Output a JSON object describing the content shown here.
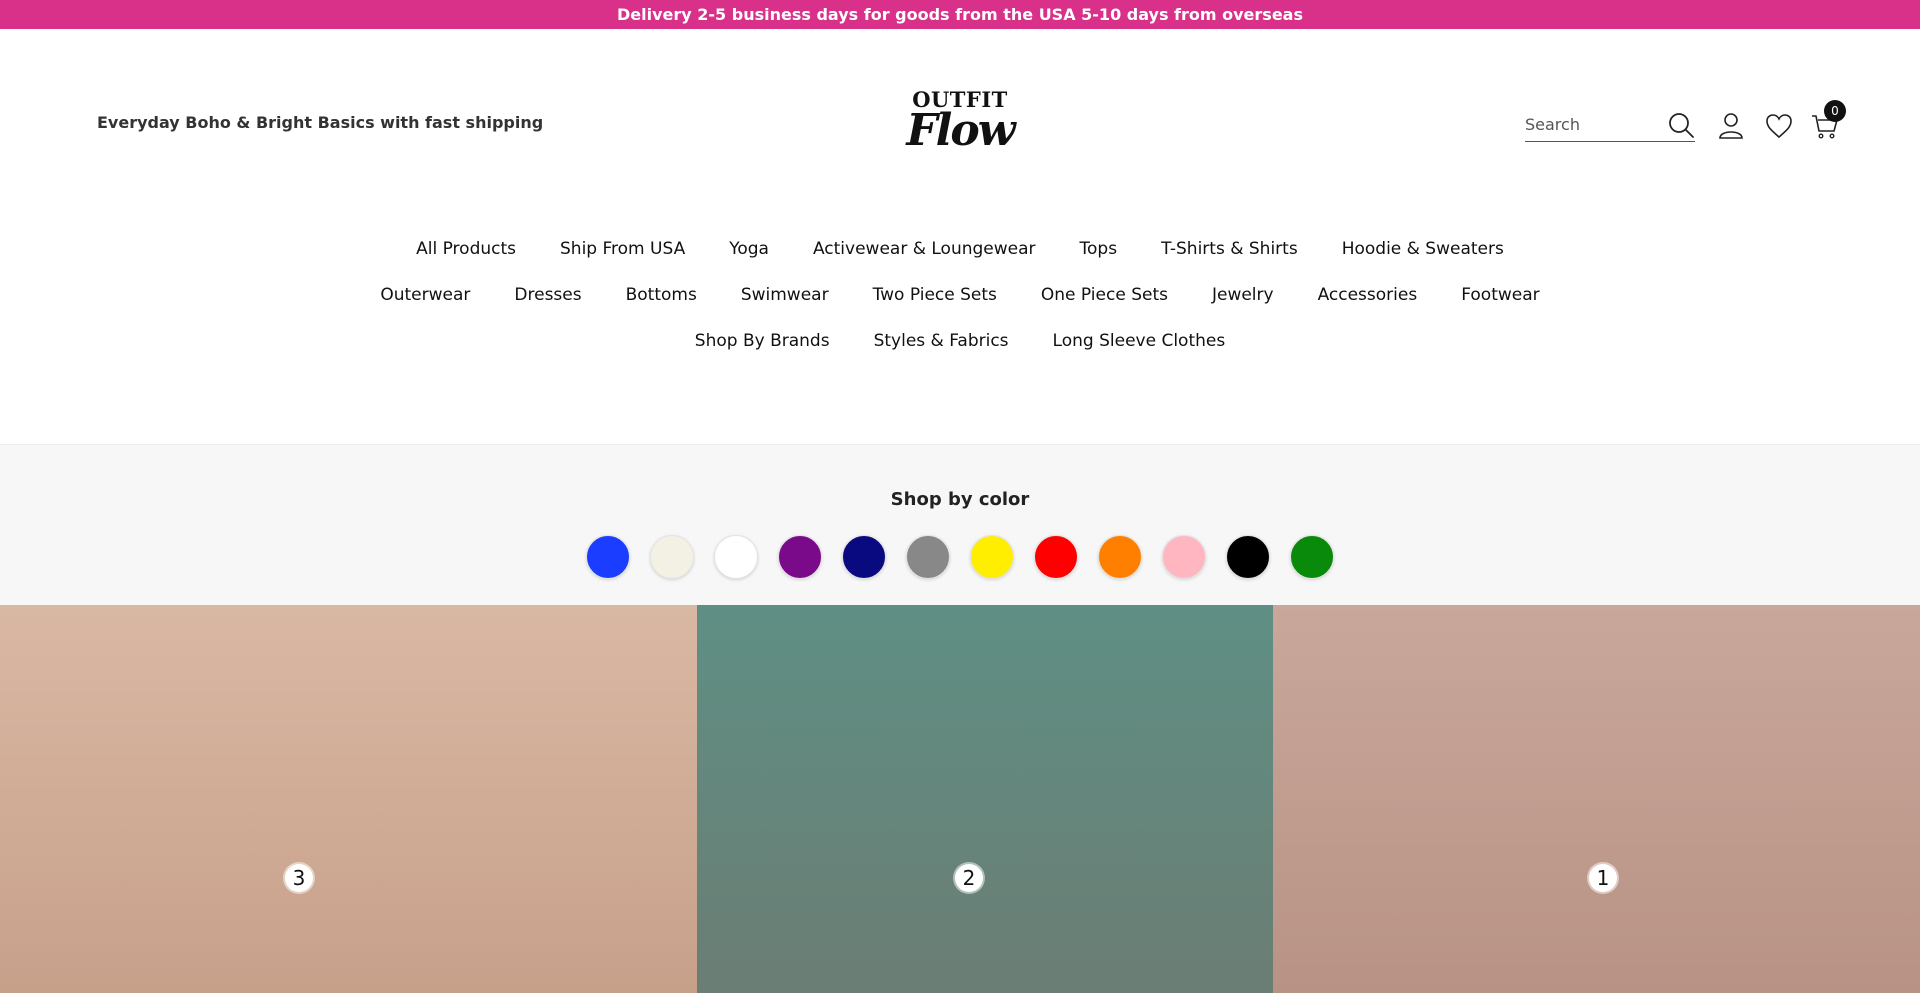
{
  "announcement": {
    "text": "Delivery 2-5 business days for goods from the USA 5-10 days from overseas"
  },
  "header": {
    "tagline": "Everyday Boho & Bright Basics with fast shipping",
    "logo": {
      "top": "OUTFIT",
      "bottom": "Flow"
    },
    "search": {
      "placeholder": "Search"
    },
    "cart_count": "0"
  },
  "nav": {
    "row1": [
      "All Products",
      "Ship From USA",
      "Yoga",
      "Activewear & Loungewear",
      "Tops",
      "T-Shirts & Shirts",
      "Hoodie & Sweaters"
    ],
    "row2": [
      "Outerwear",
      "Dresses",
      "Bottoms",
      "Swimwear",
      "Two Piece Sets",
      "One Piece Sets",
      "Jewelry",
      "Accessories",
      "Footwear"
    ],
    "row3": [
      "Shop By Brands",
      "Styles & Fabrics",
      "Long Sleeve Clothes"
    ]
  },
  "shop_by_color": {
    "title": "Shop by color",
    "colors": [
      "#1a3dff",
      "#f3f1e3",
      "#ffffff",
      "#7a0a8a",
      "#0a0a80",
      "#888888",
      "#ffee00",
      "#ff0000",
      "#ff8000",
      "#ffb6c1",
      "#000000",
      "#0a8a0a"
    ]
  },
  "gallery": {
    "hotspots": [
      "3",
      "2",
      "1"
    ]
  },
  "icons": {
    "search": "search-icon",
    "user": "user-icon",
    "wishlist": "heart-icon",
    "cart": "cart-icon"
  }
}
